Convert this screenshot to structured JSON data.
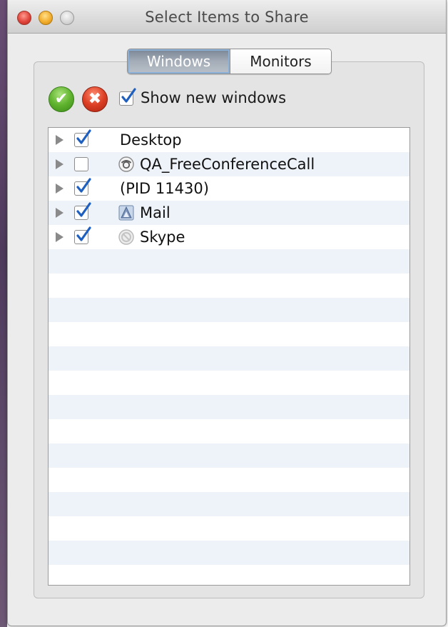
{
  "window": {
    "title": "Select Items to Share"
  },
  "tabs": [
    {
      "label": "Windows",
      "selected": true
    },
    {
      "label": "Monitors",
      "selected": false
    }
  ],
  "toolbar": {
    "select_all_icon": "checkmark-icon",
    "deselect_all_icon": "x-icon",
    "show_new_windows": {
      "label": "Show new windows",
      "checked": true
    }
  },
  "items": [
    {
      "label": "Desktop",
      "checked": true,
      "icon": null
    },
    {
      "label": "QA_FreeConferenceCall",
      "checked": false,
      "icon": "phone-icon"
    },
    {
      "label": "(PID 11430)",
      "checked": true,
      "icon": null
    },
    {
      "label": "Mail",
      "checked": true,
      "icon": "mail-icon"
    },
    {
      "label": "Skype",
      "checked": true,
      "icon": "skype-icon"
    }
  ],
  "colors": {
    "accent_check": "#1f5fbf",
    "stripe": "#eef3f9",
    "select_all_green": "#5fb32e",
    "deselect_all_red": "#dc3f24"
  }
}
